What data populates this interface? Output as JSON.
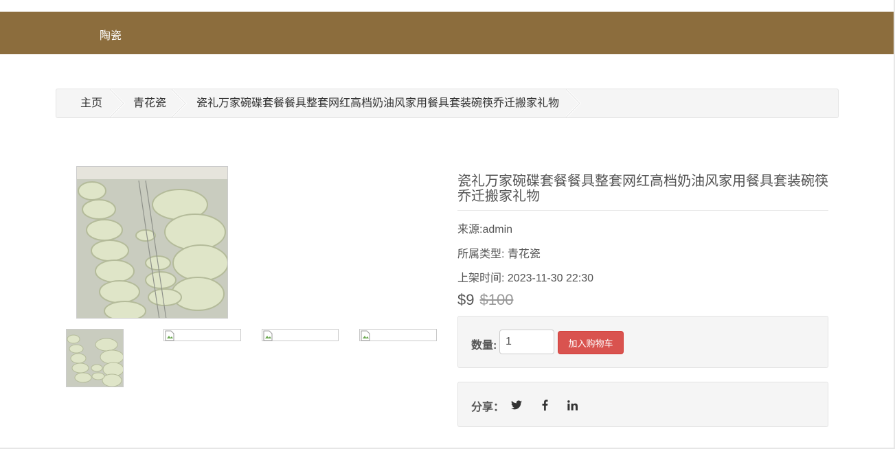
{
  "nav": {
    "brand_link": "陶瓷"
  },
  "breadcrumb": {
    "home": "主页",
    "category": "青花瓷",
    "current": "瓷礼万家碗碟套餐餐具整套网红高档奶油风家用餐具套装碗筷乔迁搬家礼物"
  },
  "product": {
    "title": "瓷礼万家碗碟套餐餐具整套网红高档奶油风家用餐具套装碗筷乔迁搬家礼物",
    "source": "来源:admin",
    "type_line": "所属类型: 青花瓷",
    "listed_line": "上架时间: 2023-11-30 22:30",
    "price": "$9",
    "original_price": "$100"
  },
  "purchase": {
    "quantity_label": "数量:",
    "quantity_value": "1",
    "add_to_cart": "加入购物车"
  },
  "share": {
    "label": "分享：",
    "icons": [
      "twitter-icon",
      "facebook-icon",
      "linkedin-icon"
    ]
  },
  "colors": {
    "navbar": "#8c6d3d",
    "cart_button": "#d9534f"
  }
}
